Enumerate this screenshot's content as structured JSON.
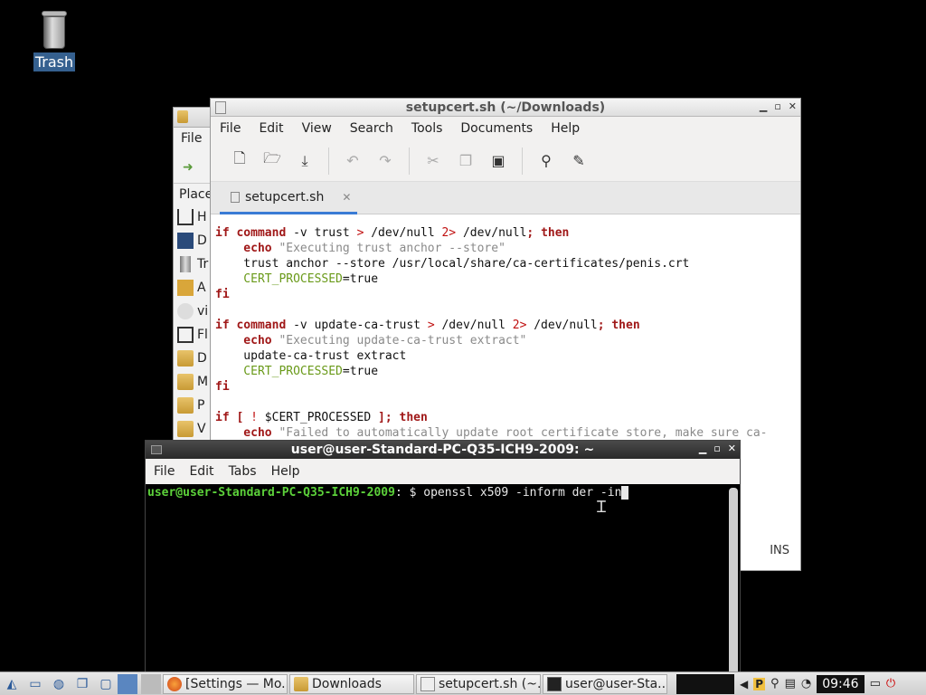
{
  "desktop": {
    "trash_label": "Trash"
  },
  "file_manager": {
    "menu_file": "File",
    "places_label": "Place",
    "places": [
      {
        "label": "H",
        "icon": "home-icon"
      },
      {
        "label": "D",
        "icon": "desktop-icon"
      },
      {
        "label": "Tr",
        "icon": "trash-icon"
      },
      {
        "label": "A",
        "icon": "applications-icon"
      },
      {
        "label": "vi",
        "icon": "disc-icon"
      },
      {
        "label": "Fl",
        "icon": "floppy-icon"
      },
      {
        "label": "D",
        "icon": "folder-icon"
      },
      {
        "label": "M",
        "icon": "folder-icon"
      },
      {
        "label": "P",
        "icon": "folder-icon"
      },
      {
        "label": "V",
        "icon": "folder-icon"
      }
    ]
  },
  "editor": {
    "title": "setupcert.sh (~/Downloads)",
    "menu": [
      "File",
      "Edit",
      "View",
      "Search",
      "Tools",
      "Documents",
      "Help"
    ],
    "tab_label": "setupcert.sh",
    "status_mode": "INS",
    "code": {
      "l1a": "if ",
      "l1b": "command",
      "l1c": " -v trust ",
      "l1d": ">",
      "l1e": " /dev/null ",
      "l1f": "2>",
      "l1g": " /dev/null",
      "l1h": "; then",
      "l2a": "    echo",
      "l2b": " \"Executing trust anchor --store\"",
      "l3": "    trust anchor --store /usr/local/share/ca-certificates/penis.crt",
      "l4a": "    CERT_PROCESSED",
      "l4b": "=true",
      "l5": "fi",
      "l7a": "if ",
      "l7b": "command",
      "l7c": " -v update-ca-trust ",
      "l7d": ">",
      "l7e": " /dev/null ",
      "l7f": "2>",
      "l7g": " /dev/null",
      "l7h": "; then",
      "l8a": "    echo",
      "l8b": " \"Executing update-ca-trust extract\"",
      "l9": "    update-ca-trust extract",
      "l10a": "    CERT_PROCESSED",
      "l10b": "=true",
      "l11": "fi",
      "l13a": "if [ ",
      "l13b": "!",
      "l13c": " $CERT_PROCESSED ",
      "l13d": "]; then",
      "l14a": "    echo",
      "l14b": " \"Failed to automatically update root certificate store, make sure ca-"
    }
  },
  "terminal": {
    "title": "user@user-Standard-PC-Q35-ICH9-2009: ~",
    "menu": [
      "File",
      "Edit",
      "Tabs",
      "Help"
    ],
    "prompt": "user@user-Standard-PC-Q35-ICH9-2009",
    "prompt_suffix": ": $ ",
    "command": "openssl x509 -inform der -in"
  },
  "taskbar": {
    "tasks": [
      {
        "label": "[Settings — Mo...",
        "icon": "firefox-icon"
      },
      {
        "label": "Downloads",
        "icon": "folder-icon"
      },
      {
        "label": "setupcert.sh (~...",
        "icon": "text-editor-icon"
      },
      {
        "label": "user@user-Sta...",
        "icon": "terminal-icon"
      }
    ],
    "clock": "09:46"
  }
}
